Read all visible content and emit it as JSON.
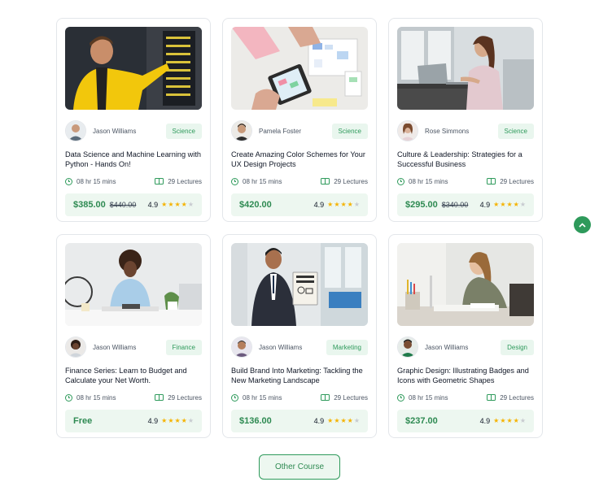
{
  "courses": [
    {
      "author": "Jason Williams",
      "category": "Science",
      "title": "Data Science and Machine Learning with Python - Hands On!",
      "duration": "08 hr 15 mins",
      "lectures": "29 Lectures",
      "price": "$385.00",
      "old_price": "$440.00",
      "rating": "4.9",
      "rating_value": 4
    },
    {
      "author": "Pamela Foster",
      "category": "Science",
      "title": "Create Amazing Color Schemes for Your UX Design Projects",
      "duration": "08 hr 15 mins",
      "lectures": "29 Lectures",
      "price": "$420.00",
      "old_price": "",
      "rating": "4.9",
      "rating_value": 4
    },
    {
      "author": "Rose Simmons",
      "category": "Science",
      "title": "Culture & Leadership: Strategies for a Successful Business",
      "duration": "08 hr 15 mins",
      "lectures": "29 Lectures",
      "price": "$295.00",
      "old_price": "$340.00",
      "rating": "4.9",
      "rating_value": 4
    },
    {
      "author": "Jason Williams",
      "category": "Finance",
      "title": "Finance Series: Learn to Budget and Calculate your Net Worth.",
      "duration": "08 hr 15 mins",
      "lectures": "29 Lectures",
      "price": "Free",
      "old_price": "",
      "rating": "4.9",
      "rating_value": 4
    },
    {
      "author": "Jason Williams",
      "category": "Marketing",
      "title": "Build Brand Into Marketing: Tackling the New Marketing Landscape",
      "duration": "08 hr 15 mins",
      "lectures": "29 Lectures",
      "price": "$136.00",
      "old_price": "",
      "rating": "4.9",
      "rating_value": 4
    },
    {
      "author": "Jason Williams",
      "category": "Design",
      "title": "Graphic Design: Illustrating Badges and Icons with Geometric Shapes",
      "duration": "08 hr 15 mins",
      "lectures": "29 Lectures",
      "price": "$237.00",
      "old_price": "",
      "rating": "4.9",
      "rating_value": 4
    }
  ],
  "other_course_label": "Other Course",
  "icons": {
    "duration": "clock-icon",
    "lectures": "lecture-icon",
    "scroll_top": "chevron-up-icon"
  },
  "colors": {
    "accent": "#2e9a5b",
    "price_bg": "#edf7f0",
    "star": "#f5b301"
  }
}
